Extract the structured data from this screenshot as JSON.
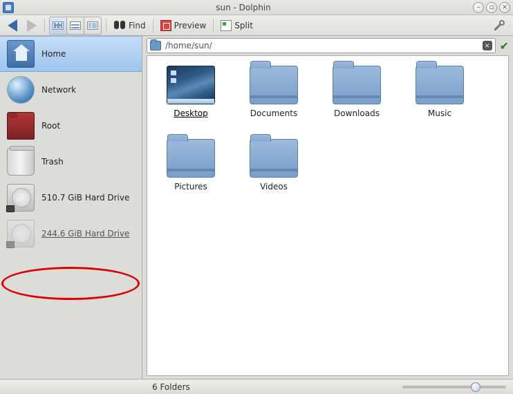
{
  "window": {
    "title": "sun - Dolphin"
  },
  "toolbar": {
    "find": "Find",
    "preview": "Preview",
    "split": "Split"
  },
  "location": {
    "path": "/home/sun/"
  },
  "places": [
    {
      "label": "Home",
      "icon": "home",
      "selected": true
    },
    {
      "label": "Network",
      "icon": "net"
    },
    {
      "label": "Root",
      "icon": "root"
    },
    {
      "label": "Trash",
      "icon": "trash"
    },
    {
      "label": "510.7 GiB Hard Drive",
      "icon": "hdd"
    },
    {
      "label": "244.6 GiB Hard Drive",
      "icon": "hdd-dim",
      "highlighted": true
    }
  ],
  "items": [
    {
      "name": "Desktop",
      "icon": "desktop",
      "selected": true
    },
    {
      "name": "Documents",
      "icon": "folder"
    },
    {
      "name": "Downloads",
      "icon": "folder"
    },
    {
      "name": "Music",
      "icon": "folder"
    },
    {
      "name": "Pictures",
      "icon": "folder"
    },
    {
      "name": "Videos",
      "icon": "folder"
    }
  ],
  "status": {
    "text": "6 Folders"
  }
}
